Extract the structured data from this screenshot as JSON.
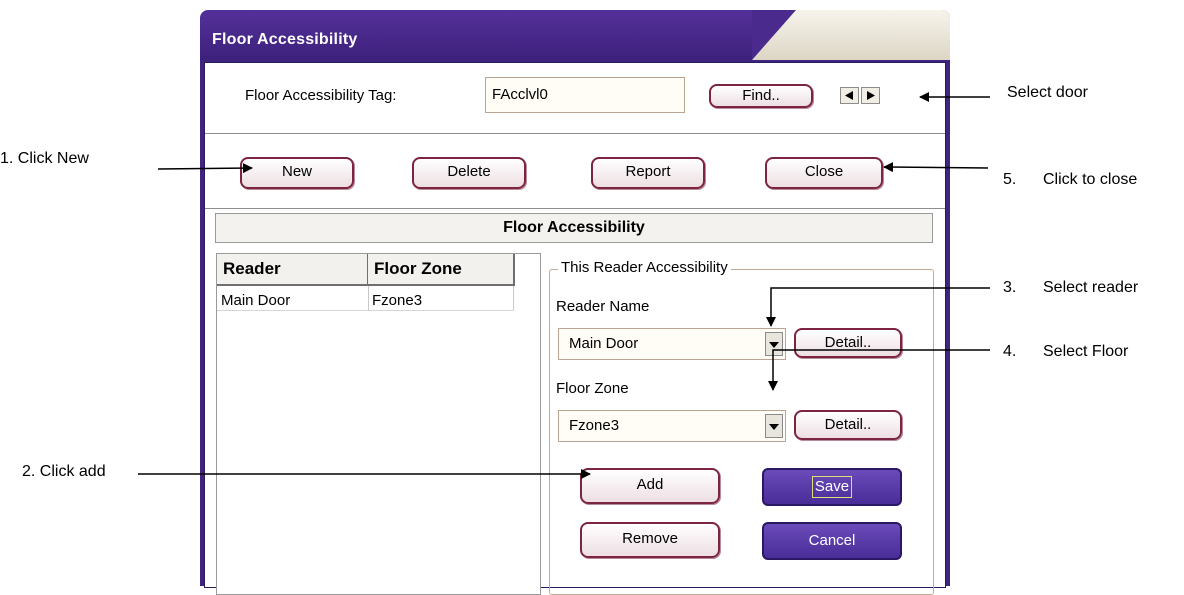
{
  "window": {
    "title": "Floor Accessibility"
  },
  "tag": {
    "label": "Floor Accessibility Tag:",
    "value": "FAcclvl0",
    "find_label": "Find.."
  },
  "toolbar": {
    "new": "New",
    "delete": "Delete",
    "report": "Report",
    "close": "Close"
  },
  "section_title": "Floor Accessibility",
  "table": {
    "headers": [
      "Reader",
      "Floor Zone"
    ],
    "rows": [
      [
        "Main Door",
        "Fzone3"
      ]
    ]
  },
  "reader_group": {
    "title": "This Reader Accessibility",
    "reader_name_label": "Reader Name",
    "reader_value": "Main Door",
    "floor_zone_label": "Floor Zone",
    "floor_value": "Fzone3",
    "detail": "Detail..",
    "add": "Add",
    "save": "Save",
    "remove": "Remove",
    "cancel": "Cancel"
  },
  "annotations": {
    "select_door": "Select door",
    "click_new": "1. Click New",
    "click_to_close_num": "5.",
    "click_to_close": "Click to close",
    "select_reader_num": "3.",
    "select_reader": "Select reader",
    "select_floor_num": "4.",
    "select_floor": "Select Floor",
    "click_add": "2. Click add"
  },
  "colors": {
    "title_bar": "#4a2a8c",
    "button_border": "#7c2440",
    "primary_button": "#5a3da9"
  }
}
